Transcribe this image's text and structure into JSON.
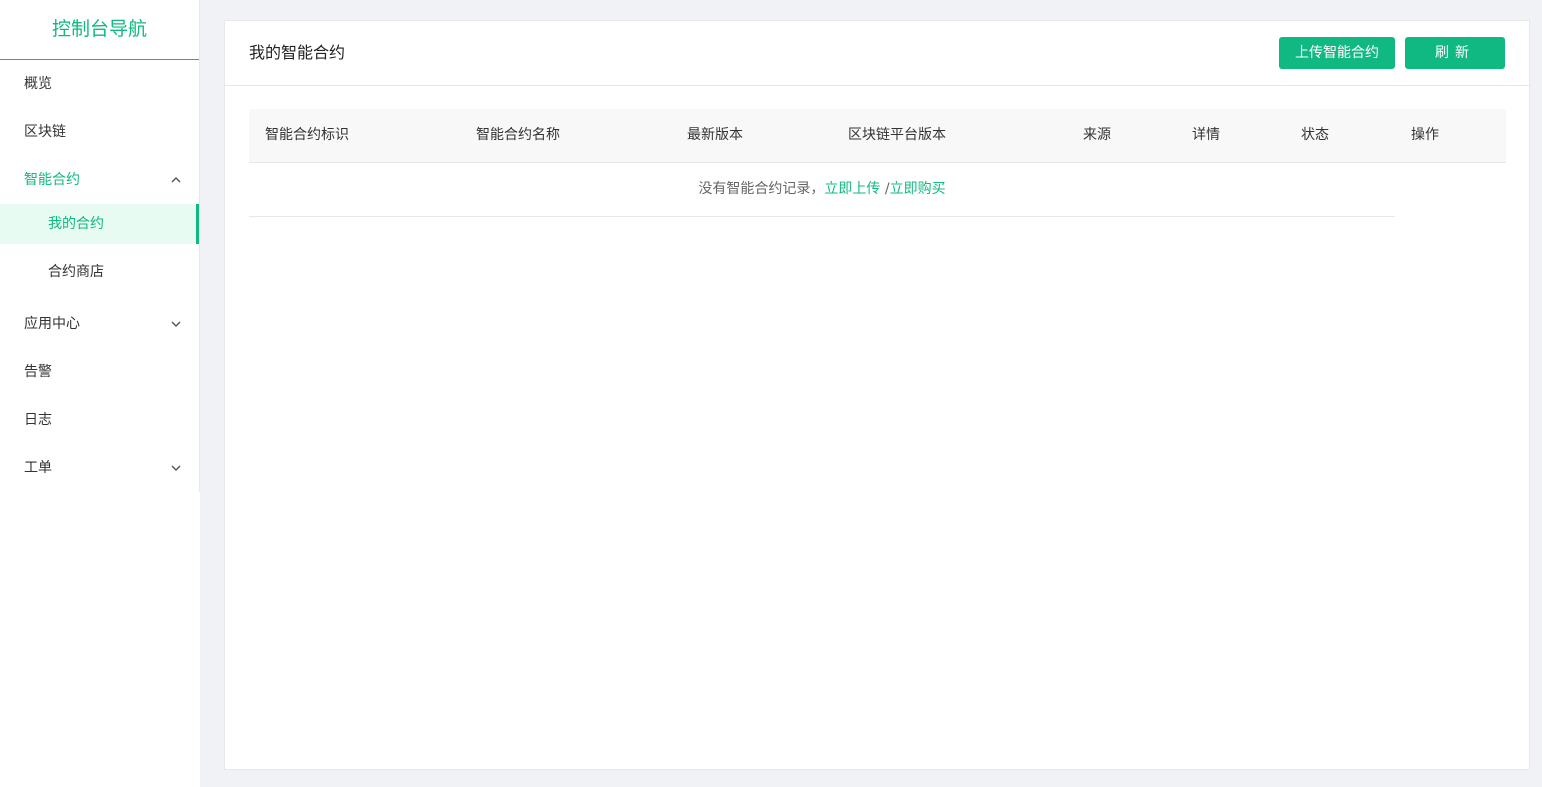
{
  "sidebar": {
    "title": "控制台导航",
    "items": [
      {
        "label": "概览"
      },
      {
        "label": "区块链"
      },
      {
        "label": "智能合约",
        "expanded": true,
        "children": [
          {
            "label": "我的合约",
            "selected": true
          },
          {
            "label": "合约商店"
          }
        ]
      },
      {
        "label": "应用中心",
        "expanded": false
      },
      {
        "label": "告警"
      },
      {
        "label": "日志"
      },
      {
        "label": "工单",
        "expanded": false
      }
    ]
  },
  "header": {
    "title": "我的智能合约",
    "upload_label": "上传智能合约",
    "refresh_label": "刷新"
  },
  "table": {
    "columns": [
      "智能合约标识",
      "智能合约名称",
      "最新版本",
      "区块链平台版本",
      "来源",
      "详情",
      "状态",
      "操作"
    ],
    "empty_text": "没有智能合约记录，",
    "upload_link": "立即上传",
    "separator": "/",
    "buy_link": "立即购买"
  },
  "colors": {
    "accent": "#10b981",
    "selected_bg": "#e8fbf3",
    "page_bg": "#f0f2f5"
  },
  "icons": {
    "caret_up": "chevron-up-icon",
    "caret_down": "chevron-down-icon"
  }
}
